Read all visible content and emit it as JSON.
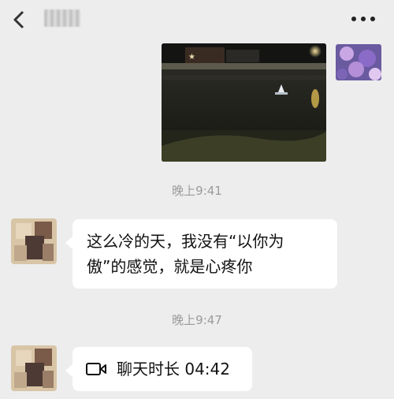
{
  "header": {
    "back_icon": "chevron-left-icon",
    "contact_name": "",
    "more_icon": "ellipsis-icon"
  },
  "messages": [
    {
      "type": "timestamp",
      "text": "晚上9:41"
    },
    {
      "type": "text",
      "lines": [
        "这么冷的天，我没有“以你为",
        "傲”的感觉，就是心疼你"
      ]
    },
    {
      "type": "timestamp",
      "text": "晚上9:47"
    },
    {
      "type": "video-call",
      "icon": "video-call-icon",
      "text": "聊天时长 04:42"
    }
  ],
  "colors": {
    "background": "#ededed",
    "bubble": "#ffffff",
    "timestamp": "#9b9b9b"
  }
}
